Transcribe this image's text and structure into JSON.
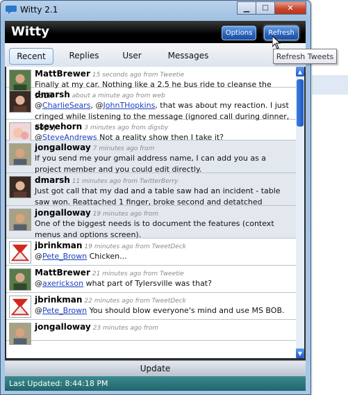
{
  "window": {
    "title": "Witty 2.1",
    "caption": {
      "minimize": "▁",
      "maximize": "☐",
      "close": "✕"
    }
  },
  "header": {
    "brand": "Witty",
    "options_label": "Options",
    "refresh_label": "Refresh"
  },
  "tabs": [
    {
      "label": "Recent",
      "active": true
    },
    {
      "label": "Replies",
      "active": false
    },
    {
      "label": "User",
      "active": false
    },
    {
      "label": "Messages",
      "active": false
    }
  ],
  "tooltip": "Refresh Tweets",
  "tweets": [
    {
      "user": "MattBrewer",
      "meta": "15 seconds ago from Tweetie",
      "parts": [
        [
          "t",
          "Finally at my car. Nothing like a 2.5 he bus ride to cleanse the soul!"
        ]
      ],
      "avatar": "man-green",
      "alt": false
    },
    {
      "user": "dmarsh",
      "meta": "about a minute ago from web",
      "parts": [
        [
          "t",
          "@"
        ],
        [
          "m",
          "CharlieSears"
        ],
        [
          "t",
          ", @"
        ],
        [
          "m",
          "JohnTHopkins"
        ],
        [
          "t",
          ", that was about my reaction. I just cringed while listening to the message (ignored call during dinner, oops)"
        ]
      ],
      "avatar": "woman-dark",
      "alt": false
    },
    {
      "user": "stevehorn",
      "meta": "3 minutes ago from digsby",
      "parts": [
        [
          "t",
          "@"
        ],
        [
          "m",
          "SteveAndrews"
        ],
        [
          "t",
          " Not a reality show then I take it?"
        ]
      ],
      "avatar": "baby",
      "alt": false
    },
    {
      "user": "jongalloway",
      "meta": "7 minutes ago from",
      "parts": [
        [
          "t",
          "If you send me your gmail address name, I can add you as a project member and you could edit directly."
        ]
      ],
      "avatar": "man-tan",
      "alt": true
    },
    {
      "user": "dmarsh",
      "meta": "11 minutes ago from TwitterBerry",
      "parts": [
        [
          "t",
          "Just got call that my dad and a table saw had an incident - table saw won. Reattached 1 finger, broke second and detatched tendon. Eek!"
        ]
      ],
      "avatar": "woman-dark",
      "alt": true
    },
    {
      "user": "jongalloway",
      "meta": "19 minutes ago from",
      "parts": [
        [
          "t",
          "One of the biggest needs is to document the features (context menus and options screen)."
        ]
      ],
      "avatar": "man-tan",
      "alt": true
    },
    {
      "user": "jbrinkman",
      "meta": "19 minutes ago from TweetDeck",
      "parts": [
        [
          "t",
          "@"
        ],
        [
          "m",
          "Pete_Brown"
        ],
        [
          "t",
          " Chicken..."
        ]
      ],
      "avatar": "red-logo",
      "alt": false
    },
    {
      "user": "MattBrewer",
      "meta": "21 minutes ago from Tweetie",
      "parts": [
        [
          "t",
          "@"
        ],
        [
          "m",
          "axerickson"
        ],
        [
          "t",
          " what part of Tylersville was that?"
        ]
      ],
      "avatar": "man-green",
      "alt": false
    },
    {
      "user": "jbrinkman",
      "meta": "22 minutes ago from TweetDeck",
      "parts": [
        [
          "t",
          "@"
        ],
        [
          "m",
          "Pete_Brown"
        ],
        [
          "t",
          " You should blow everyone's mind and use  MS BOB."
        ]
      ],
      "avatar": "red-logo",
      "alt": false
    },
    {
      "user": "jongalloway",
      "meta": "23 minutes ago from",
      "parts": [],
      "avatar": "man-tan",
      "alt": false
    }
  ],
  "scrollbar": {
    "up": "▲",
    "down": "▼"
  },
  "update_label": "Update",
  "status_text": "Last Updated: 8:44:18 PM",
  "colors": {
    "header": "#000000",
    "button_blue": "#2d64bb",
    "status_teal": "#2b787d",
    "mention": "#1a3fbf"
  }
}
